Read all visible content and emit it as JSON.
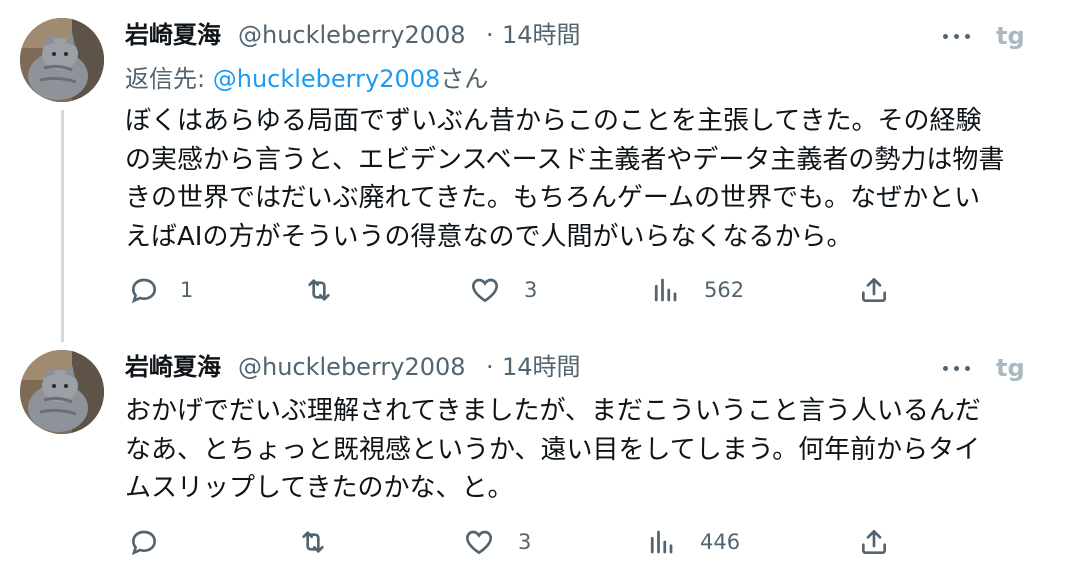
{
  "tweets": [
    {
      "author_name": "岩崎夏海",
      "handle": "@huckleberry2008",
      "separator": "·",
      "time": "14時間",
      "reply_label": "返信先:",
      "reply_mention": "@huckleberry2008",
      "reply_suffix": "さん",
      "lines": [
        "ぼくはあらゆる局面でずいぶん昔からこのことを主張してきた。その経験",
        "の実感から言うと、エビデンスベースド主義者やデータ主義者の勢力は物書",
        "きの世界ではだいぶ廃れてきた。もちろんゲームの世界でも。なぜかとい",
        "えばAIの方がそういうの得意なので人間がいらなくなるから。"
      ],
      "actions": {
        "reply_count": "1",
        "retweet_count": "",
        "like_count": "3",
        "views_count": "562"
      }
    },
    {
      "author_name": "岩崎夏海",
      "handle": "@huckleberry2008",
      "separator": "·",
      "time": "14時間",
      "lines": [
        "おかげでだいぶ理解されてきましたが、まだこういうこと言う人いるんだ",
        "なあ、とちょっと既視感というか、遠い目をしてしまう。何年前からタイ",
        "ムスリップしてきたのかな、と。"
      ],
      "actions": {
        "reply_count": "",
        "retweet_count": "",
        "like_count": "3",
        "views_count": "446"
      }
    }
  ],
  "icons": [
    "avatar-cat",
    "more-icon",
    "tg-logo-icon",
    "reply-icon",
    "retweet-icon",
    "like-icon",
    "views-icon",
    "share-icon"
  ],
  "colors": {
    "text": "#0f1419",
    "secondary": "#536471",
    "link": "#1d9bf0",
    "thread_line": "#cfd9de"
  }
}
